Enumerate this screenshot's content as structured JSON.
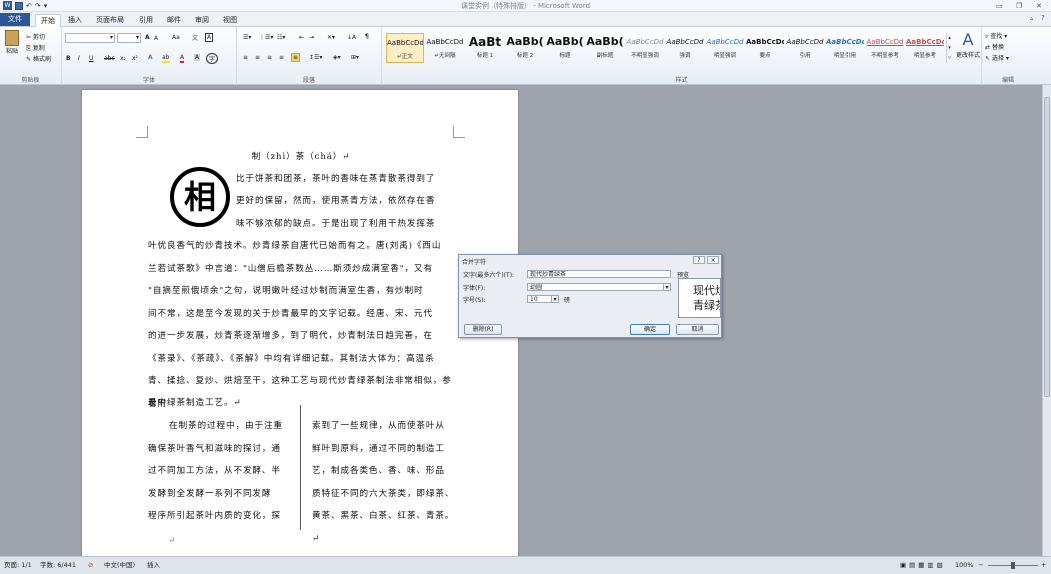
{
  "window": {
    "title": "课堂实例（特殊排版） - Microsoft Word",
    "qat_icons": [
      "word-icon",
      "save-icon",
      "undo-icon",
      "redo-icon",
      "customize-icon"
    ]
  },
  "tabs": [
    "文件",
    "开始",
    "插入",
    "页面布局",
    "引用",
    "邮件",
    "审阅",
    "视图"
  ],
  "ribbon": {
    "clipboard": {
      "paste": "粘贴",
      "cut": "剪切",
      "copy": "复制",
      "painter": "格式刷",
      "label": "剪贴板"
    },
    "font": {
      "label": "字体",
      "size_symbol": "A",
      "clear": "Aa"
    },
    "paragraph": {
      "label": "段落"
    },
    "styles": {
      "label": "样式",
      "items": [
        {
          "sample": "AaBbCcDd",
          "name": "↵正文"
        },
        {
          "sample": "AaBbCcDd",
          "name": "↵无间隔"
        },
        {
          "sample": "AaBt",
          "name": "标题 1"
        },
        {
          "sample": "AaBb(",
          "name": "标题 2"
        },
        {
          "sample": "AaBb(",
          "name": "标题"
        },
        {
          "sample": "AaBb(",
          "name": "副标题"
        },
        {
          "sample": "AaBbCcDd",
          "name": "不明显强调"
        },
        {
          "sample": "AaBbCcDd",
          "name": "强调"
        },
        {
          "sample": "AaBbCcDd",
          "name": "明显强调"
        },
        {
          "sample": "AaBbCcDd",
          "name": "要点"
        },
        {
          "sample": "AaBbCcDd",
          "name": "引用"
        },
        {
          "sample": "AaBbCcDd",
          "name": "明显引用"
        },
        {
          "sample": "AaBbCcDd",
          "name": "不明显参考"
        },
        {
          "sample": "AaBbCcDd",
          "name": "明显参考"
        }
      ],
      "change_styles": "更改样式"
    },
    "editing": {
      "find": "查找",
      "replace": "替换",
      "select": "选择",
      "label": "编辑"
    }
  },
  "document": {
    "title_line": "制（zhì）茶（chá）↵",
    "drop_cap": "相",
    "paragraph1": [
      "比于饼茶和团茶，茶叶的香味在蒸青散茶得到了",
      "更好的保留，然而，使用蒸青方法，依然存在香",
      "味不够浓郁的缺点。于是出现了利用干热发挥茶",
      "叶优良香气的炒青技术。炒青绿茶自唐代已始而有之。唐(刘禹)《西山",
      "兰若试茶歌》中言道：\"山僧后檐茶数丛……斯须炒成满室香\"，又有",
      "\"自摘至煎俄顷余\"之句，说明嫩叶经过炒制而满室生香，有炒制时",
      "间不常，这是至今发现的关于炒青最早的文字记载。经唐、宋、元代",
      "的进一步发展，炒青茶逐渐增多，到了明代，炒青制法日趋完善，在",
      "《茶录》、《茶疏》、《茶解》中均有详细记载。其制法大体为：高温杀",
      "青、揉捻、复炒、烘焙至干，这种工艺与现代炒青绿茶制法非常相似，参看附",
      "录中绿茶制造工艺。↵"
    ],
    "col_left": [
      "在制茶的过程中，由于注重",
      "确保茶叶香气和滋味的探讨，通",
      "过不同加工方法，从不发酵、半",
      "发酵到全发酵一系列不同发酵",
      "程序所引起茶叶内质的变化，探"
    ],
    "col_right": [
      "索到了一些规律，从而使茶叶从",
      "鲜叶到原料，通过不同的制造工",
      "艺，制成各类色、香、味、形品",
      "质特征不同的六大茶类，即绿茶、",
      "黄茶、黑茶、白茶、红茶、青茶。↵"
    ],
    "empty_para": "↵"
  },
  "dialog": {
    "title": "合并字符",
    "help": "?",
    "close": "×",
    "text_label": "文字(最多六个)(T):",
    "text_value": "现代炒青绿茶",
    "font_label": "字体(F):",
    "font_value": "幼圆",
    "size_label": "字号(S):",
    "size_value": "10",
    "size_unit": "磅",
    "preview_label": "预览",
    "preview_line1": "现代炒",
    "preview_line2": "青绿茶",
    "delete_button": "删除(R)",
    "ok_button": "确定",
    "cancel_button": "取消"
  },
  "status": {
    "page": "页面: 1/1",
    "words": "字数: 6/441",
    "language": "中文(中国)",
    "mode": "插入",
    "zoom": "100%",
    "zoom_minus": "−",
    "zoom_plus": "+"
  }
}
